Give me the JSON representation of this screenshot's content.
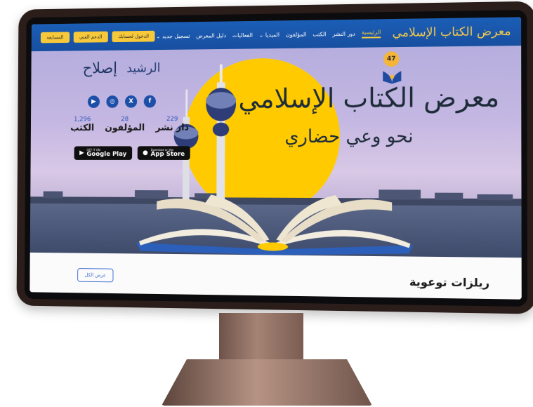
{
  "navbar": {
    "logo_text": "معرض الكتاب الإسلامي",
    "links": [
      {
        "label": "الرئيسية",
        "active": true
      },
      {
        "label": "دور النشر"
      },
      {
        "label": "الكتب"
      },
      {
        "label": "المؤلفون"
      },
      {
        "label": "الميديا ⌄"
      },
      {
        "label": "الفعاليات"
      },
      {
        "label": "دليل المعرض"
      },
      {
        "label": "تسجيل جديد ⌄"
      }
    ],
    "actions": [
      {
        "label": "الدخول لحسابك"
      },
      {
        "label": "الدعم الفني"
      },
      {
        "label": "المسابقة"
      }
    ]
  },
  "hero": {
    "edition": "47",
    "title": "معرض الكتاب الإسلامي",
    "slogan": "نحو وعي حضاري",
    "partners": [
      "إصلاح",
      "الرشيد"
    ],
    "socials": [
      "youtube-icon",
      "instagram-icon",
      "x-icon",
      "facebook-icon"
    ],
    "stats": [
      {
        "number": "229",
        "label": "دار نشر"
      },
      {
        "number": "28",
        "label": "المؤلفون"
      },
      {
        "number": "1,296",
        "label": "الكتب"
      }
    ],
    "stores": [
      {
        "sub": "GET IT ON",
        "main": "Google Play",
        "icon": "google-play-icon"
      },
      {
        "sub": "Download on the",
        "main": "App Store",
        "icon": "apple-icon"
      }
    ]
  },
  "section": {
    "title": "ريلزات توعوية",
    "view_all": "عرض الكل"
  },
  "colors": {
    "nav_blue": "#1b5eb6",
    "accent_yellow": "#f7c93a",
    "sun": "#ffcb00",
    "link_blue": "#3d6bd1"
  }
}
